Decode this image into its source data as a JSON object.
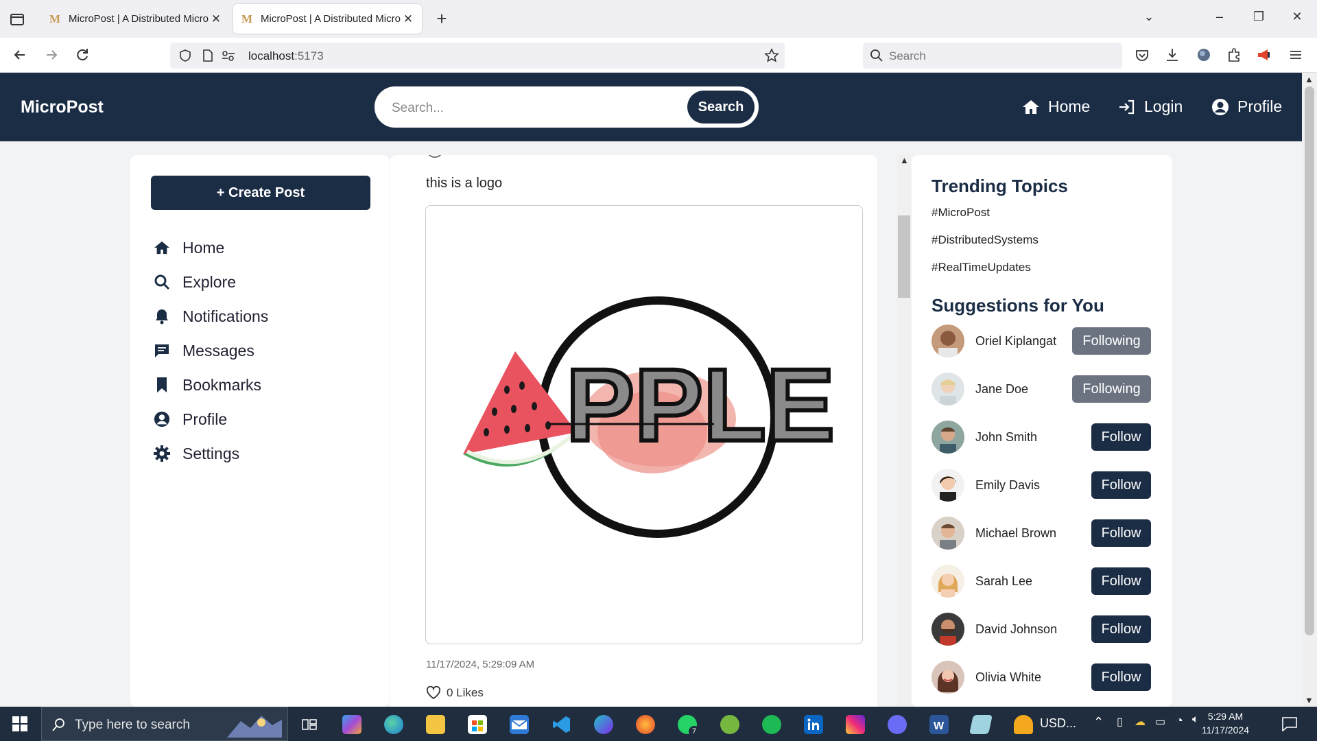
{
  "browser": {
    "tabs": [
      {
        "favicon": "M",
        "title": "MicroPost | A Distributed Micro",
        "active": false
      },
      {
        "favicon": "M",
        "title": "MicroPost | A Distributed Micro",
        "active": true
      }
    ],
    "url_host": "localhost",
    "url_port": ":5173",
    "search_placeholder": "Search"
  },
  "app": {
    "brand": "MicroPost",
    "search_placeholder": "Search...",
    "search_button": "Search",
    "nav": {
      "home": "Home",
      "login": "Login",
      "profile": "Profile"
    }
  },
  "sidebar": {
    "create_post": "+ Create Post",
    "items": [
      {
        "label": "Home",
        "icon": "home-icon"
      },
      {
        "label": "Explore",
        "icon": "search-icon"
      },
      {
        "label": "Notifications",
        "icon": "bell-icon"
      },
      {
        "label": "Messages",
        "icon": "message-icon"
      },
      {
        "label": "Bookmarks",
        "icon": "bookmark-icon"
      },
      {
        "label": "Profile",
        "icon": "user-circle-icon"
      },
      {
        "label": "Settings",
        "icon": "gear-icon"
      }
    ]
  },
  "post": {
    "text": "this is a logo",
    "image_wordmark": "PPLE",
    "timestamp": "11/17/2024, 5:29:09 AM",
    "likes": "0 Likes"
  },
  "right": {
    "trending_title": "Trending Topics",
    "topics": [
      "#MicroPost",
      "#DistributedSystems",
      "#RealTimeUpdates"
    ],
    "suggestions_title": "Suggestions for You",
    "suggestions": [
      {
        "name": "Oriel Kiplangat",
        "action": "Following"
      },
      {
        "name": "Jane Doe",
        "action": "Following"
      },
      {
        "name": "John Smith",
        "action": "Follow"
      },
      {
        "name": "Emily Davis",
        "action": "Follow"
      },
      {
        "name": "Michael Brown",
        "action": "Follow"
      },
      {
        "name": "Sarah Lee",
        "action": "Follow"
      },
      {
        "name": "David Johnson",
        "action": "Follow"
      },
      {
        "name": "Olivia White",
        "action": "Follow"
      }
    ]
  },
  "taskbar": {
    "search_placeholder": "Type here to search",
    "whatsapp_badge": "7",
    "tray_text": "USD...",
    "time": "5:29 AM",
    "date": "11/17/2024"
  },
  "colors": {
    "primary": "#1b2d45",
    "following": "#6b7280"
  }
}
